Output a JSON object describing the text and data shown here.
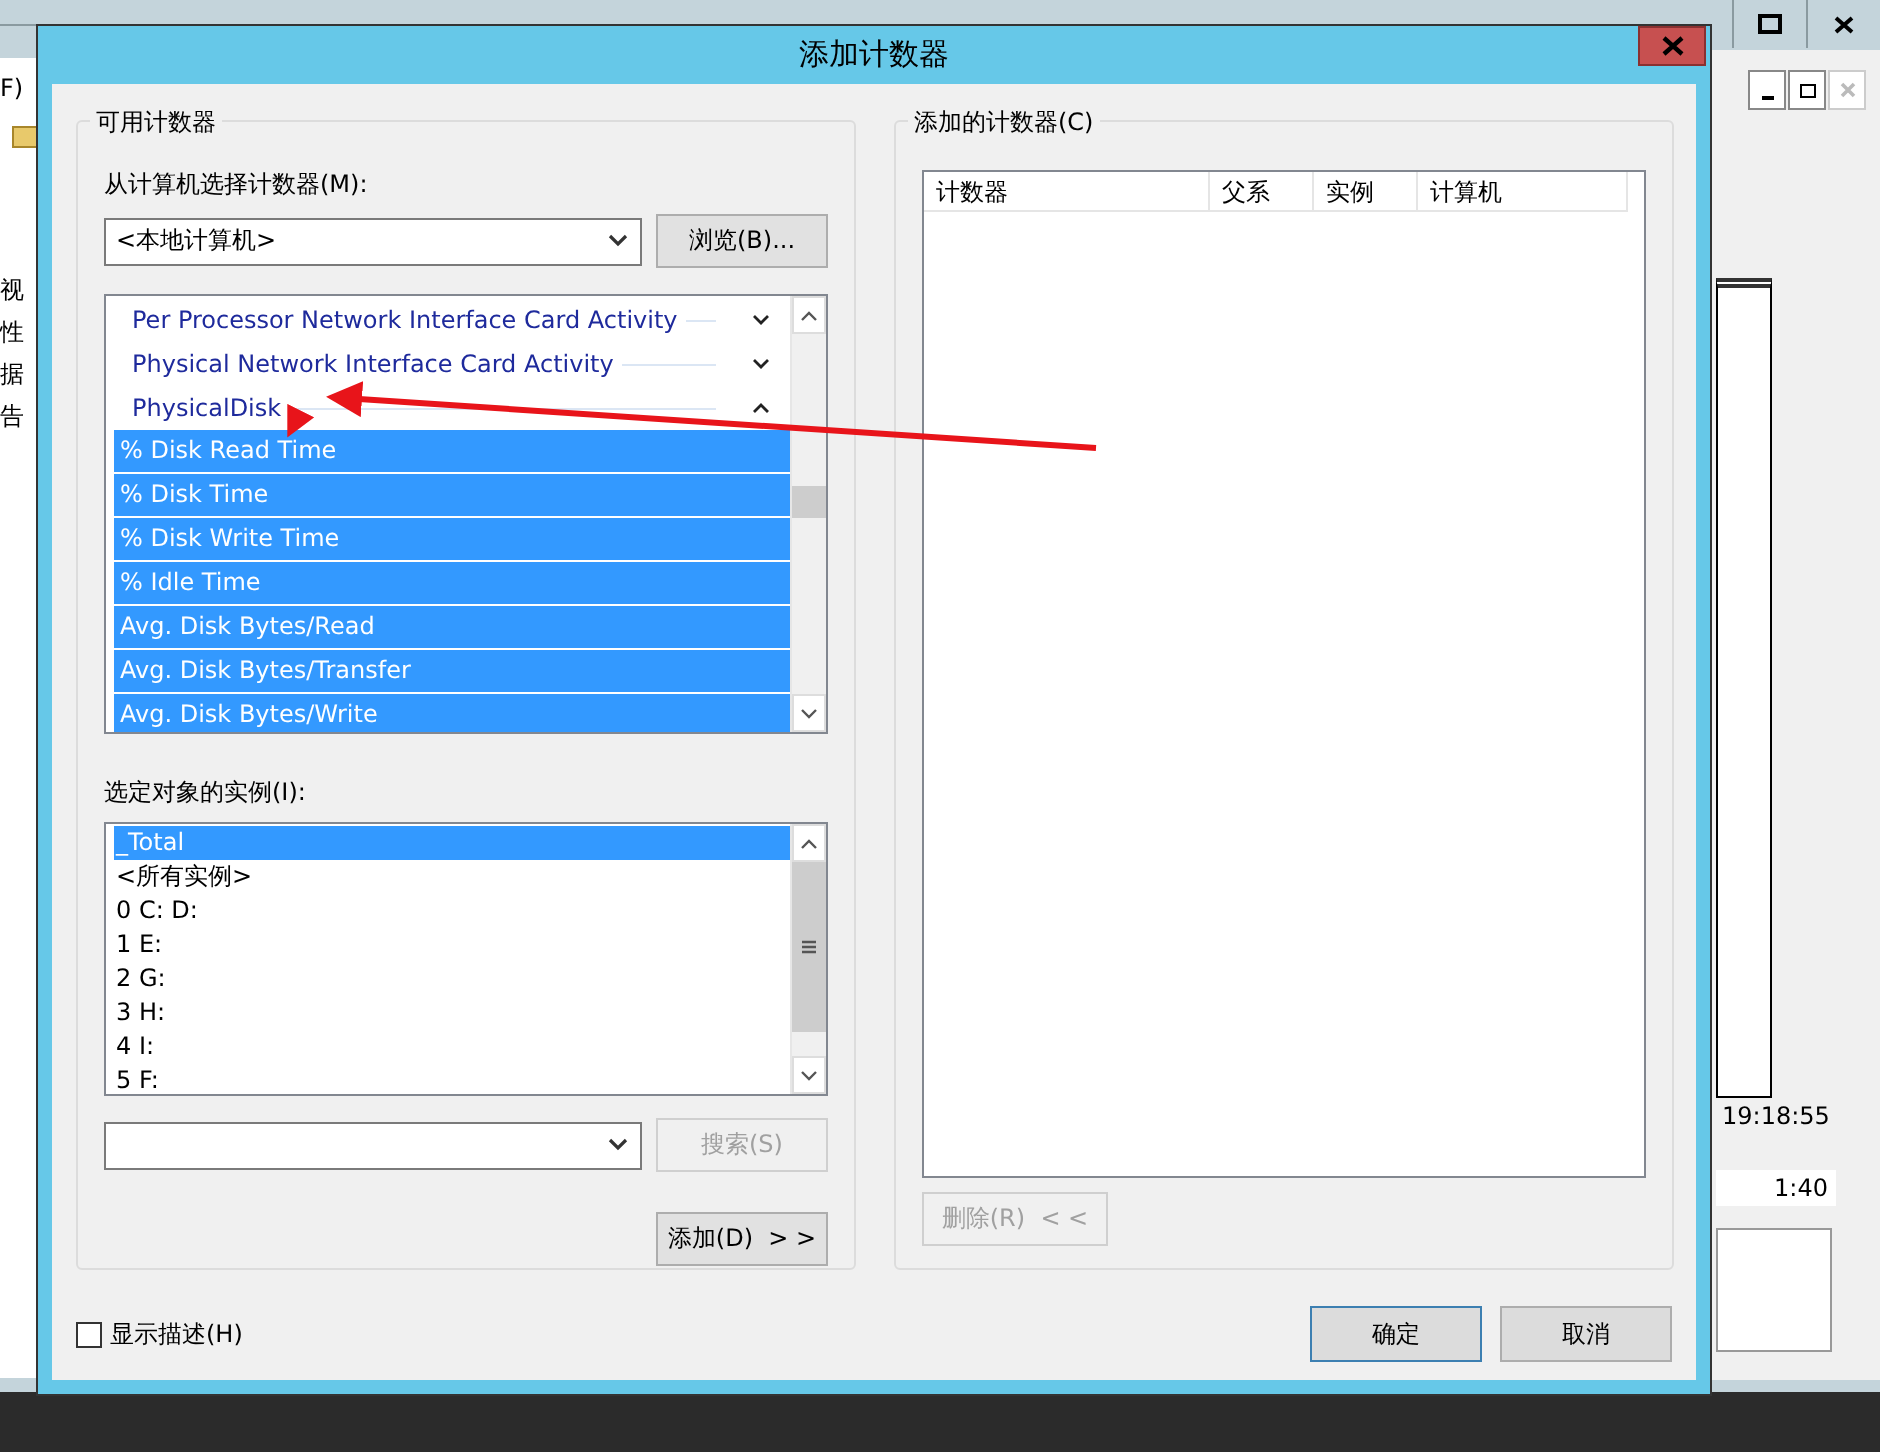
{
  "background_window": {
    "menu_fragment": "F)",
    "tree_fragments": [
      "视",
      "性",
      "据",
      "告"
    ],
    "time_label": "19:18:55",
    "duration": "1:40"
  },
  "dialog": {
    "title": "添加计数器",
    "available": {
      "legend": "可用计数器",
      "computer_label": "从计算机选择计数器(M):",
      "computer_value": "<本地计算机>",
      "browse_button": "浏览(B)...",
      "counters": [
        {
          "kind": "category",
          "label": "Per Processor Network Interface Card Activity",
          "expanded": false
        },
        {
          "kind": "category",
          "label": "Physical Network Interface Card Activity",
          "expanded": false
        },
        {
          "kind": "category",
          "label": "PhysicalDisk",
          "expanded": true
        },
        {
          "kind": "counter",
          "label": "% Disk Read Time",
          "selected": true
        },
        {
          "kind": "counter",
          "label": "% Disk Time",
          "selected": true
        },
        {
          "kind": "counter",
          "label": "% Disk Write Time",
          "selected": true
        },
        {
          "kind": "counter",
          "label": "% Idle Time",
          "selected": true
        },
        {
          "kind": "counter",
          "label": "Avg. Disk Bytes/Read",
          "selected": true
        },
        {
          "kind": "counter",
          "label": "Avg. Disk Bytes/Transfer",
          "selected": true
        },
        {
          "kind": "counter",
          "label": "Avg. Disk Bytes/Write",
          "selected": true
        }
      ],
      "instances_label": "选定对象的实例(I):",
      "instances": [
        {
          "label": "_Total",
          "selected": true
        },
        {
          "label": "<所有实例>",
          "selected": false
        },
        {
          "label": "0 C: D:",
          "selected": false
        },
        {
          "label": "1 E:",
          "selected": false
        },
        {
          "label": "2 G:",
          "selected": false
        },
        {
          "label": "3 H:",
          "selected": false
        },
        {
          "label": "4 I:",
          "selected": false
        },
        {
          "label": "5 F:",
          "selected": false
        }
      ],
      "search_button": {
        "label": "搜索(S)",
        "disabled": true
      },
      "add_button": {
        "label": "添加(D)  > >",
        "disabled": false
      }
    },
    "added": {
      "legend": "添加的计数器(C)",
      "columns": [
        "计数器",
        "父系",
        "实例",
        "计算机"
      ],
      "remove_button": {
        "label": "删除(R)  < <",
        "disabled": true
      }
    },
    "show_description": {
      "label": "显示描述(H)",
      "checked": false
    },
    "ok_button": "确定",
    "cancel_button": "取消"
  }
}
